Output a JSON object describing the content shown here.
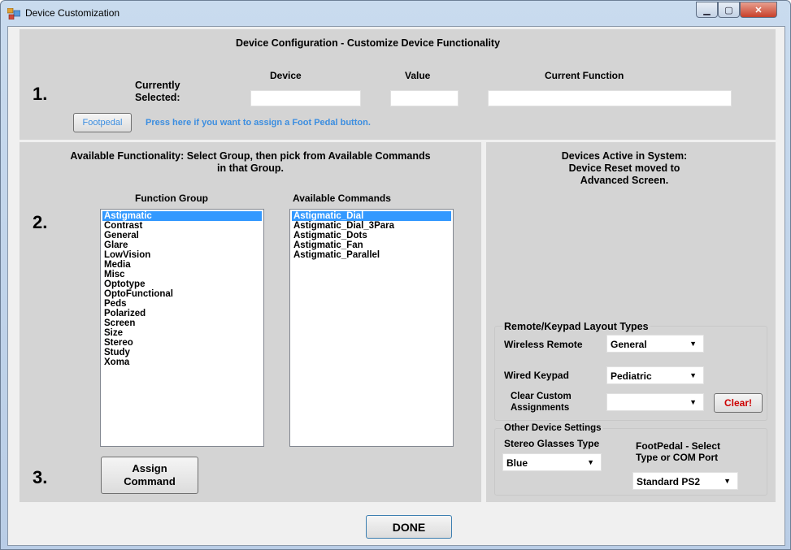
{
  "window": {
    "title": "Device Customization"
  },
  "header": {
    "title": "Device Configuration - Customize Device Functionality"
  },
  "section1": {
    "step": "1.",
    "currently_selected": [
      "Currently",
      "Selected:"
    ],
    "col_device": "Device",
    "col_value": "Value",
    "col_function": "Current Function",
    "device_value": "",
    "value_value": "",
    "function_value": "",
    "footpedal_button": "Footpedal",
    "footpedal_hint": "Press here if you want to assign a Foot Pedal button."
  },
  "section2": {
    "step": "2.",
    "heading": [
      "Available Functionality: Select Group, then pick from Available Commands",
      "in that Group."
    ],
    "function_group_label": "Function Group",
    "available_commands_label": "Available Commands",
    "function_groups": [
      "Astigmatic",
      "Contrast",
      "General",
      "Glare",
      "LowVision",
      "Media",
      "Misc",
      "Optotype",
      "OptoFunctional",
      "Peds",
      "Polarized",
      "Screen",
      "Size",
      "Stereo",
      "Study",
      "Xoma"
    ],
    "selected_group": "Astigmatic",
    "commands": [
      "Astigmatic_Dial",
      "Astigmatic_Dial_3Para",
      "Astigmatic_Dots",
      "Astigmatic_Fan",
      "Astigmatic_Parallel"
    ],
    "selected_command": "Astigmatic_Dial"
  },
  "section3": {
    "step": "3.",
    "assign_button": [
      "Assign",
      "Command"
    ]
  },
  "right_panel": {
    "devices_active": [
      "Devices Active in System:",
      "Device Reset moved to",
      "Advanced Screen."
    ],
    "layout_group_title": "Remote/Keypad Layout Types",
    "wireless_remote_label": "Wireless Remote",
    "wireless_remote_value": "General",
    "wired_keypad_label": "Wired Keypad",
    "wired_keypad_value": "Pediatric",
    "clear_custom_label": [
      "Clear Custom",
      "Assignments"
    ],
    "clear_custom_value": "",
    "clear_button": "Clear!",
    "other_group_title": "Other Device Settings",
    "stereo_label": "Stereo Glasses Type",
    "stereo_value": "Blue",
    "footpedal_label": [
      "FootPedal - Select",
      "Type or COM Port"
    ],
    "footpedal_value": "Standard PS2"
  },
  "done_button": "DONE",
  "colors": {
    "selection": "#3399ff",
    "hint_blue": "#3c8ee0",
    "clear_red": "#cc0000",
    "panel_gray": "#d4d4d4"
  },
  "icons": {
    "app": "app-icon",
    "dropdown": "chevron-down-icon"
  }
}
